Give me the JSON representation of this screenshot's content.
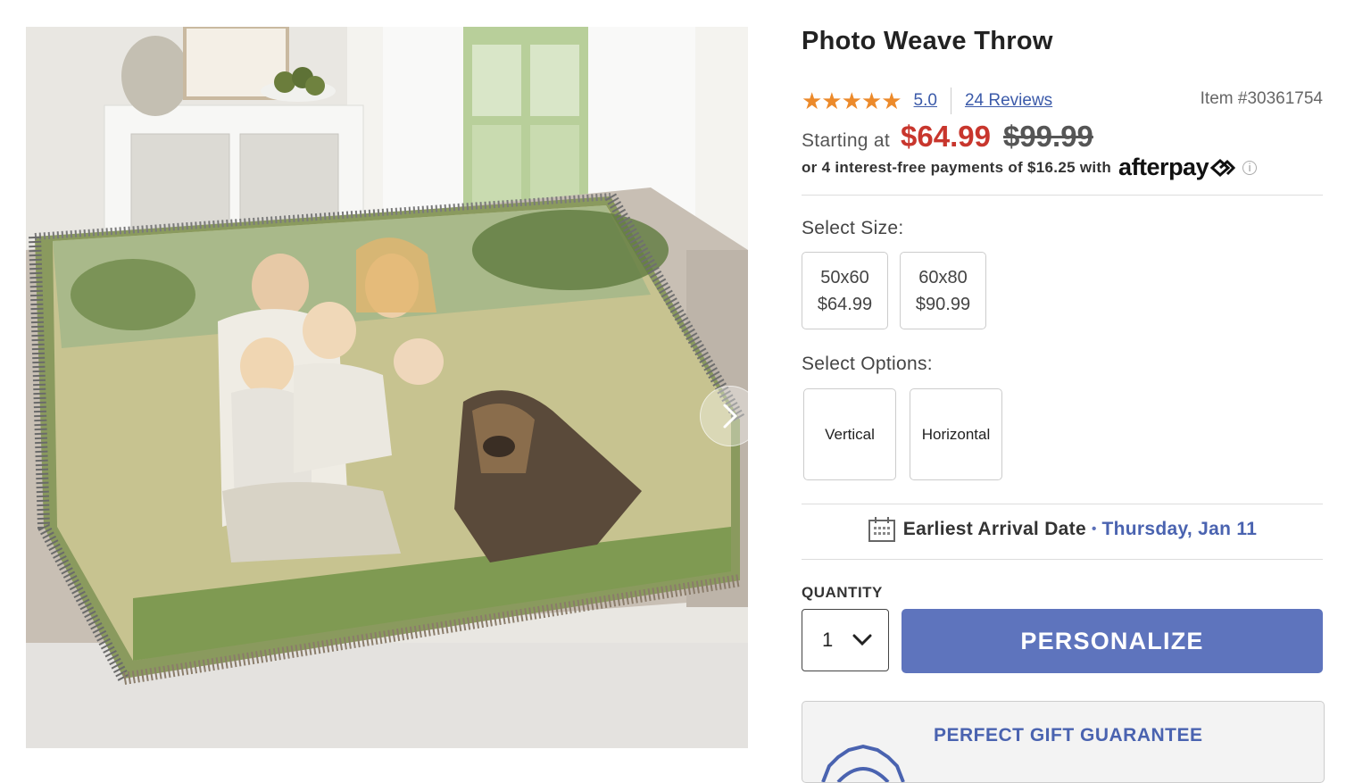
{
  "product": {
    "title": "Photo Weave Throw",
    "rating": "5.0",
    "stars": "★★★★★",
    "reviews": "24 Reviews",
    "item_number": "Item #30361754",
    "price": {
      "starting_label": "Starting at",
      "sale": "$64.99",
      "original": "$99.99"
    },
    "afterpay": {
      "text": "or 4 interest-free payments of $16.25 with",
      "logo": "afterpay",
      "info": "i"
    }
  },
  "size": {
    "label": "Select Size:",
    "options": [
      {
        "dims": "50x60",
        "price": "$64.99"
      },
      {
        "dims": "60x80",
        "price": "$90.99"
      }
    ]
  },
  "options": {
    "label": "Select Options:",
    "choices": [
      "Vertical",
      "Horizontal"
    ]
  },
  "arrival": {
    "label": "Earliest Arrival Date",
    "separator": "•",
    "date": "Thursday, Jan 11"
  },
  "quantity": {
    "label": "QUANTITY",
    "value": "1"
  },
  "cta": {
    "label": "PERSONALIZE"
  },
  "gift": {
    "title": "PERFECT GIFT GUARANTEE"
  },
  "colors": {
    "accent": "#5e74bd",
    "sale_price": "#c8362d",
    "link": "#3b5aa9",
    "star": "#ec8a2b"
  },
  "icons": [
    "chevron-right-icon",
    "info-icon",
    "calendar-icon",
    "chevron-down-icon",
    "gift-badge-icon",
    "afterpay-loop-icon"
  ]
}
